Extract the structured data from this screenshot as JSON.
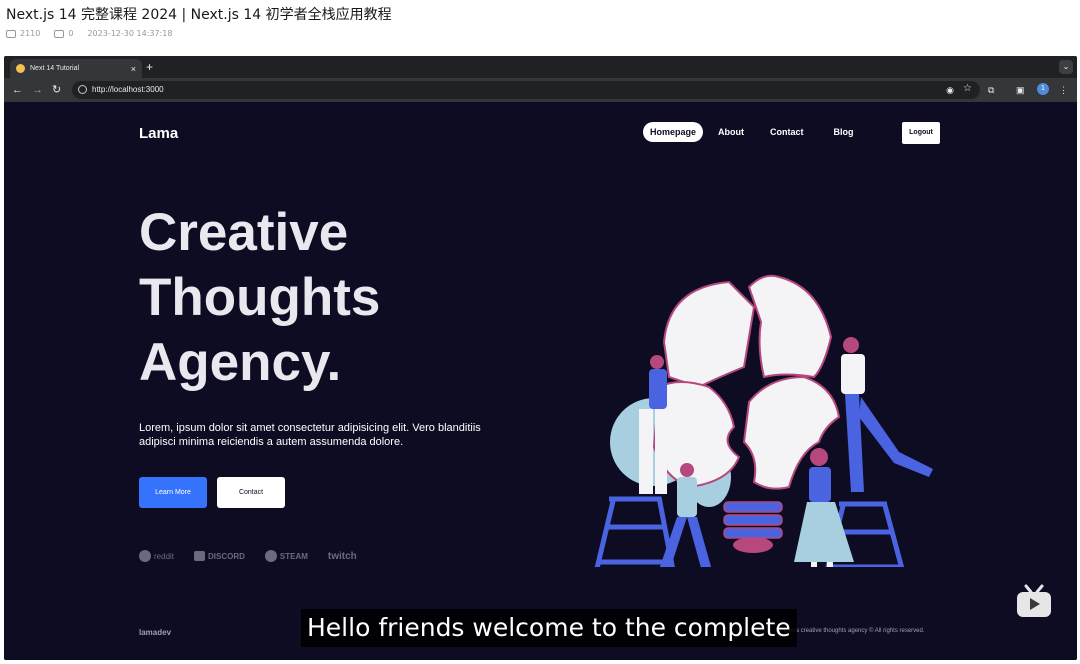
{
  "video": {
    "title": "Next.js 14 完整课程 2024 | Next.js 14 初学者全栈应用教程",
    "views": "2110",
    "comments": "0",
    "date": "2023-12-30 14:37:18"
  },
  "browser": {
    "tab_title": "Next 14 Tutorial",
    "tab_close": "×",
    "new_tab": "+",
    "url": "http://localhost:3000",
    "profile_initial": "1"
  },
  "site": {
    "logo": "Lama",
    "nav": [
      "Homepage",
      "About",
      "Contact",
      "Blog"
    ],
    "logout": "Logout",
    "hero_title_lines": [
      "Creative",
      "Thoughts",
      "Agency."
    ],
    "hero_desc": "Lorem, ipsum dolor sit amet consectetur adipisicing elit. Vero blanditiis adipisci minima reiciendis a autem assumenda dolore.",
    "learn_more": "Learn More",
    "contact_button": "Contact",
    "brands": [
      "reddit",
      "DISCORD",
      "STEAM",
      "twitch"
    ],
    "footer_logo": "lamadev",
    "footer_text": "Lama creative thoughts agency © All rights reserved."
  },
  "subtitle": "Hello friends welcome to the complete",
  "colors": {
    "site_bg": "#0d0c22",
    "accent_blue": "#3673fd",
    "illus_blue": "#4a63e0",
    "illus_pink": "#b6487d"
  },
  "icons": [
    "play-count-icon",
    "comment-icon",
    "back-icon",
    "forward-icon",
    "reload-icon",
    "site-info-icon",
    "eye-off-icon",
    "bookmark-star-icon",
    "extensions-icon",
    "sidebar-icon",
    "menu-dots-icon",
    "tv-logo-icon"
  ]
}
